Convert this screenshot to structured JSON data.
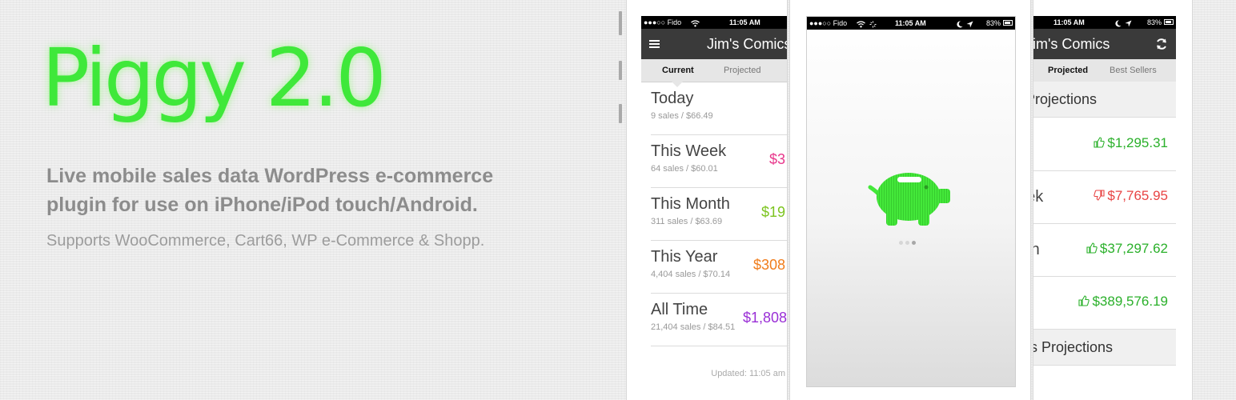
{
  "hero": {
    "title": "Piggy 2.0",
    "description": "Live mobile sales data WordPress e-commerce plugin for use on iPhone/iPod touch/Android.",
    "supports": "Supports WooCommerce, Cart66, WP e-Commerce & Shopp."
  },
  "colors": {
    "brand_green": "#3fe83a",
    "navbar": "#3a3a3a",
    "pink": "#e8388c",
    "lime": "#7cc41f",
    "orange": "#f07d1c",
    "purple": "#9a2fd6",
    "up_green": "#2ab02a",
    "down_red": "#e84444"
  },
  "phone_left": {
    "status": {
      "carrier": "●●●○○ Fido",
      "time": "11:05 AM"
    },
    "nav_title": "Jim's Comics",
    "menu_icon": "hamburger-menu-icon",
    "tabs": [
      {
        "label": "Current"
      },
      {
        "label": "Projected"
      }
    ],
    "rows": [
      {
        "title": "Today",
        "sub": "9 sales / $66.49",
        "amount": ""
      },
      {
        "title": "This Week",
        "sub": "64 sales / $60.01",
        "amount": "$3"
      },
      {
        "title": "This Month",
        "sub": "311 sales / $63.69",
        "amount": "$19"
      },
      {
        "title": "This Year",
        "sub": "4,404 sales / $70.14",
        "amount": "$308"
      },
      {
        "title": "All Time",
        "sub": "21,404 sales / $84.51",
        "amount": "$1,808"
      }
    ],
    "updated": "Updated: 11:05 am"
  },
  "phone_middle": {
    "status": {
      "carrier": "●●●○○ Fido",
      "time": "11:05 AM",
      "battery": "83%"
    },
    "logo_icon": "piggy-bank-icon",
    "dots": [
      {
        "active": false
      },
      {
        "active": false
      },
      {
        "active": true
      }
    ]
  },
  "phone_right": {
    "status": {
      "time": "11:05 AM",
      "battery": "83%"
    },
    "nav_title": "Jim's Comics",
    "refresh_icon": "refresh-icon",
    "tabs": [
      {
        "label": "Projected"
      },
      {
        "label": "Best Sellers"
      }
    ],
    "section1": "Projections",
    "rows": [
      {
        "title": "",
        "amount": "$1,295.31",
        "trend": "up"
      },
      {
        "title": "eek",
        "amount": "$7,765.95",
        "trend": "down"
      },
      {
        "title": "nth",
        "amount": "$37,297.62",
        "trend": "up"
      },
      {
        "title": "ar",
        "amount": "$389,576.19",
        "trend": "up"
      }
    ],
    "section2": "ers Projections"
  }
}
